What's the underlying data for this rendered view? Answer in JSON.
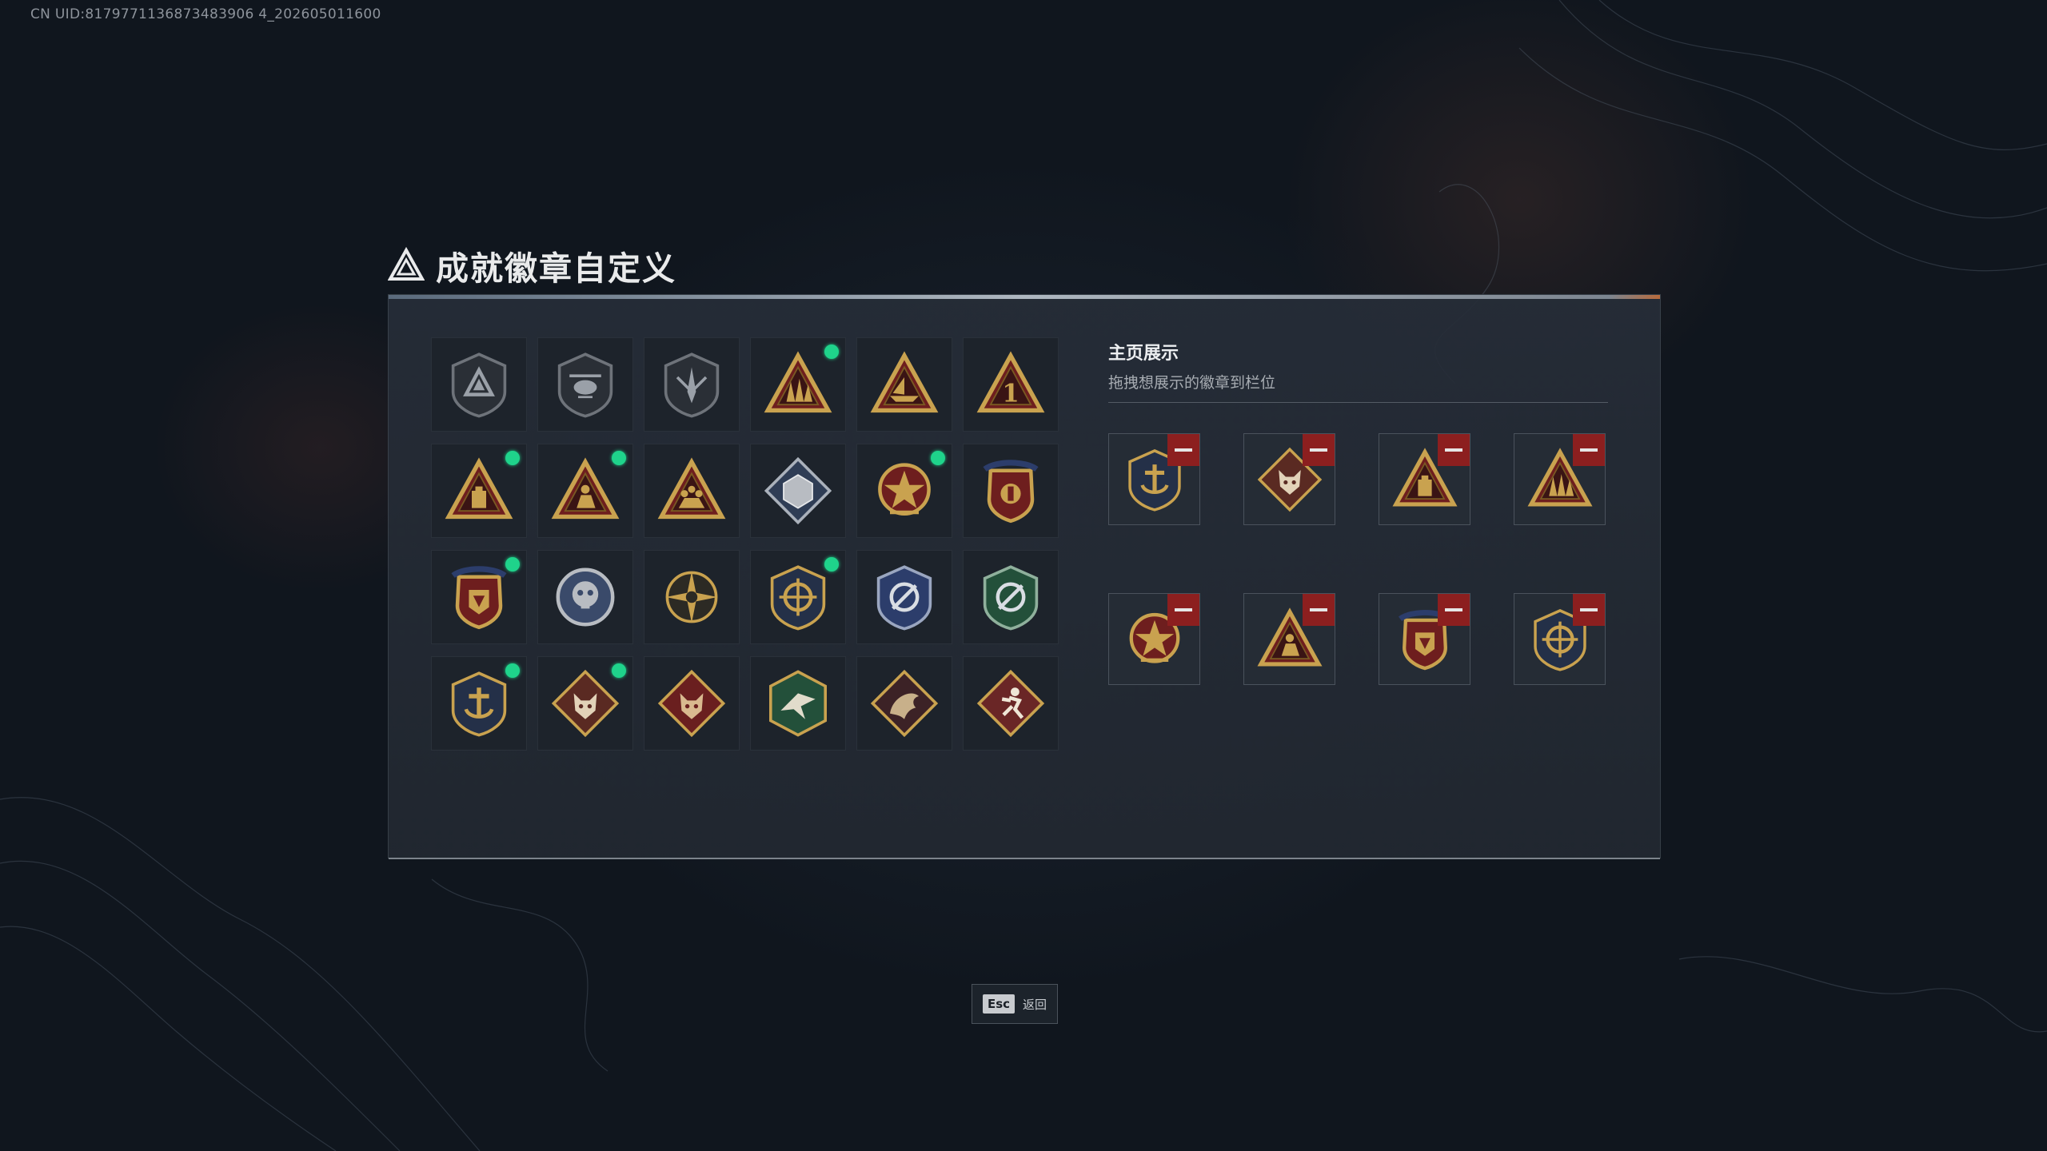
{
  "uid": "CN UID:8179771136873483906 4_202605011600",
  "title": "成就徽章自定义",
  "display": {
    "title": "主页展示",
    "subtitle": "拖拽想展示的徽章到栏位"
  },
  "badges": [
    {
      "icon": "shield-delta-badge",
      "new": false
    },
    {
      "icon": "helicopter-badge",
      "new": false
    },
    {
      "icon": "blade-shield-badge",
      "new": false
    },
    {
      "icon": "gold-rockets-badge",
      "new": true
    },
    {
      "icon": "gold-boat-badge",
      "new": false
    },
    {
      "icon": "gold-number-one-badge",
      "new": false
    },
    {
      "icon": "gold-battery-badge",
      "new": true
    },
    {
      "icon": "gold-soldier-badge",
      "new": true
    },
    {
      "icon": "gold-squad-badge",
      "new": false
    },
    {
      "icon": "silver-diamond-cube-badge",
      "new": false
    },
    {
      "icon": "star-medal-badge",
      "new": true
    },
    {
      "icon": "crest-stars-badge",
      "new": false
    },
    {
      "icon": "crest-ribbon-badge",
      "new": true
    },
    {
      "icon": "silver-skull-badge",
      "new": false
    },
    {
      "icon": "gold-compass-badge",
      "new": false
    },
    {
      "icon": "gold-crosshair-badge",
      "new": true
    },
    {
      "icon": "blue-crosshair-shield-badge",
      "new": false
    },
    {
      "icon": "green-crosshair-shield-badge",
      "new": false
    },
    {
      "icon": "gold-anchor-shield-badge",
      "new": true
    },
    {
      "icon": "wolf-diamond-badge",
      "new": true
    },
    {
      "icon": "red-wolf-diamond-badge",
      "new": false
    },
    {
      "icon": "green-bird-diamond-badge",
      "new": false
    },
    {
      "icon": "dragon-diamond-badge",
      "new": false
    },
    {
      "icon": "runner-diamond-badge",
      "new": false
    }
  ],
  "slots": [
    {
      "icon": "gold-anchor-shield-badge"
    },
    {
      "icon": "wolf-diamond-badge"
    },
    {
      "icon": "gold-battery-badge"
    },
    {
      "icon": "gold-rockets-badge"
    },
    {
      "icon": "star-medal-badge"
    },
    {
      "icon": "gold-soldier-badge"
    },
    {
      "icon": "crest-ribbon-badge"
    },
    {
      "icon": "gold-crosshair-badge"
    }
  ],
  "esc": {
    "key": "Esc",
    "label": "返回"
  },
  "colors": {
    "new_dot": "#1fd38b",
    "remove": "#8c1f1f",
    "gold": "#c9a24f"
  }
}
